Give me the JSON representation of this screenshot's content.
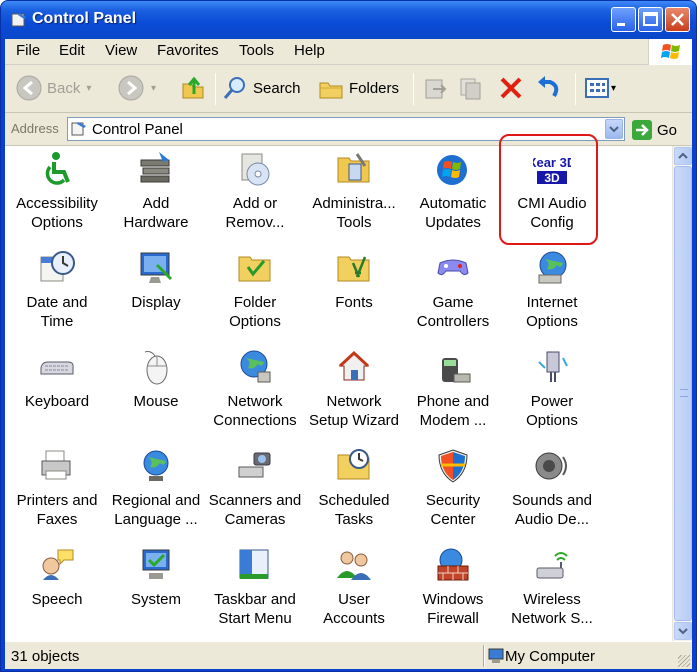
{
  "window": {
    "title": "Control Panel"
  },
  "menu": [
    "File",
    "Edit",
    "View",
    "Favorites",
    "Tools",
    "Help"
  ],
  "toolbar": {
    "back_label": "Back",
    "search_label": "Search",
    "folders_label": "Folders"
  },
  "address": {
    "label": "Address",
    "value": "Control Panel",
    "go_label": "Go"
  },
  "items": [
    {
      "label": "Accessibility\nOptions",
      "icon": "accessibility-icon"
    },
    {
      "label": "Add\nHardware",
      "icon": "add-hardware-icon"
    },
    {
      "label": "Add or\nRemov...",
      "icon": "add-remove-programs-icon"
    },
    {
      "label": "Administra...\nTools",
      "icon": "administrative-tools-icon"
    },
    {
      "label": "Automatic\nUpdates",
      "icon": "automatic-updates-icon"
    },
    {
      "label": "CMI Audio\nConfig",
      "icon": "cmi-audio-icon"
    },
    {
      "label": "Date and\nTime",
      "icon": "date-time-icon"
    },
    {
      "label": "Display",
      "icon": "display-icon"
    },
    {
      "label": "Folder\nOptions",
      "icon": "folder-options-icon"
    },
    {
      "label": "Fonts",
      "icon": "fonts-icon"
    },
    {
      "label": "Game\nControllers",
      "icon": "game-controllers-icon"
    },
    {
      "label": "Internet\nOptions",
      "icon": "internet-options-icon"
    },
    {
      "label": "Keyboard",
      "icon": "keyboard-icon"
    },
    {
      "label": "Mouse",
      "icon": "mouse-icon"
    },
    {
      "label": "Network\nConnections",
      "icon": "network-connections-icon"
    },
    {
      "label": "Network\nSetup Wizard",
      "icon": "network-setup-icon"
    },
    {
      "label": "Phone and\nModem ...",
      "icon": "phone-modem-icon"
    },
    {
      "label": "Power\nOptions",
      "icon": "power-options-icon"
    },
    {
      "label": "Printers and\nFaxes",
      "icon": "printers-icon"
    },
    {
      "label": "Regional and\nLanguage ...",
      "icon": "regional-icon"
    },
    {
      "label": "Scanners and\nCameras",
      "icon": "scanners-icon"
    },
    {
      "label": "Scheduled\nTasks",
      "icon": "scheduled-tasks-icon"
    },
    {
      "label": "Security\nCenter",
      "icon": "security-center-icon"
    },
    {
      "label": "Sounds and\nAudio De...",
      "icon": "sounds-icon"
    },
    {
      "label": "Speech",
      "icon": "speech-icon"
    },
    {
      "label": "System",
      "icon": "system-icon"
    },
    {
      "label": "Taskbar and\nStart Menu",
      "icon": "taskbar-icon"
    },
    {
      "label": "User\nAccounts",
      "icon": "user-accounts-icon"
    },
    {
      "label": "Windows\nFirewall",
      "icon": "firewall-icon"
    },
    {
      "label": "Wireless\nNetwork S...",
      "icon": "wireless-icon"
    }
  ],
  "cmi_logo_text": "Xear 3D",
  "status": {
    "count": "31 objects",
    "location": "My Computer"
  }
}
